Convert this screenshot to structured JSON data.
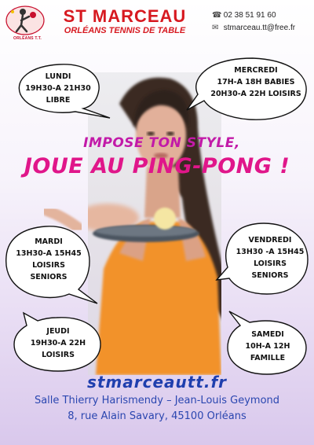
{
  "header": {
    "club_name": "ST MARCEAU",
    "club_subtitle": "ORLÉANS TENNIS DE TABLE",
    "phone": "02 38 51 91 60",
    "email": "stmarceau.tt@free.fr",
    "logo_text": "ORLÉANS T.T."
  },
  "slogan": {
    "line1": "IMPOSE TON STYLE,",
    "line2": "JOUE AU  PING-PONG !"
  },
  "schedule": {
    "lundi": [
      "LUNDI",
      "19H30-A 21H30",
      "LIBRE"
    ],
    "mercredi": [
      "MERCREDI",
      "17H-A 18H BABIES",
      "20H30-A 22H LOISIRS"
    ],
    "mardi": [
      "MARDI",
      "13H30-A 15H45",
      "LOISIRS",
      "SENIORS"
    ],
    "vendredi": [
      "VENDREDI",
      "13H30 -A 15H45",
      "LOISIRS",
      "SENIORS"
    ],
    "jeudi": [
      "JEUDI",
      "19H30-A 22H",
      "LOISIRS"
    ],
    "samedi": [
      "SAMEDI",
      "10H-A 12H",
      "FAMILLE"
    ]
  },
  "footer": {
    "website": "stmarceautt.fr",
    "venue": "Salle Thierry Harismendy – Jean-Louis Geymond",
    "address": "8, rue Alain Savary, 45100 Orléans"
  },
  "colors": {
    "club_red": "#d71920",
    "slogan_pink": "#e0168a",
    "footer_blue": "#1f3fae"
  }
}
